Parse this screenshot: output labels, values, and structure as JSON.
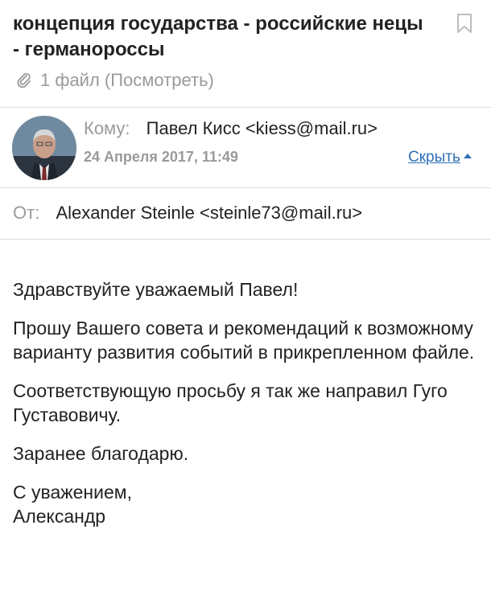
{
  "email": {
    "subject": "концепция государства - российские нецы - германороссы",
    "attachment_text": "1 файл (Посмотреть)",
    "to_label": "Кому:",
    "to_value": "Павел Кисс <kiess@mail.ru>",
    "date": "24 Апреля 2017, 11:49",
    "hide_label": "Скрыть",
    "from_label": "От:",
    "from_value": "Alexander Steinle <steinle73@mail.ru>",
    "body": {
      "p1": "Здравствуйте уважаемый Павел!",
      "p2": "Прошу Вашего совета и рекомендаций к возможному варианту развития событий в прикрепленном файле.",
      "p3": "Соответствующую просьбу я так же направил Гуго Густавовичу.",
      "p4": "Заранее благодарю.",
      "p5_line1": "С уважением,",
      "p5_line2": "Александр"
    }
  },
  "icons": [
    "bookmark-icon",
    "paperclip-icon",
    "caret-up-icon"
  ],
  "colors": {
    "link": "#2f6fb5",
    "muted": "#9a9a9a",
    "text": "#222222"
  }
}
